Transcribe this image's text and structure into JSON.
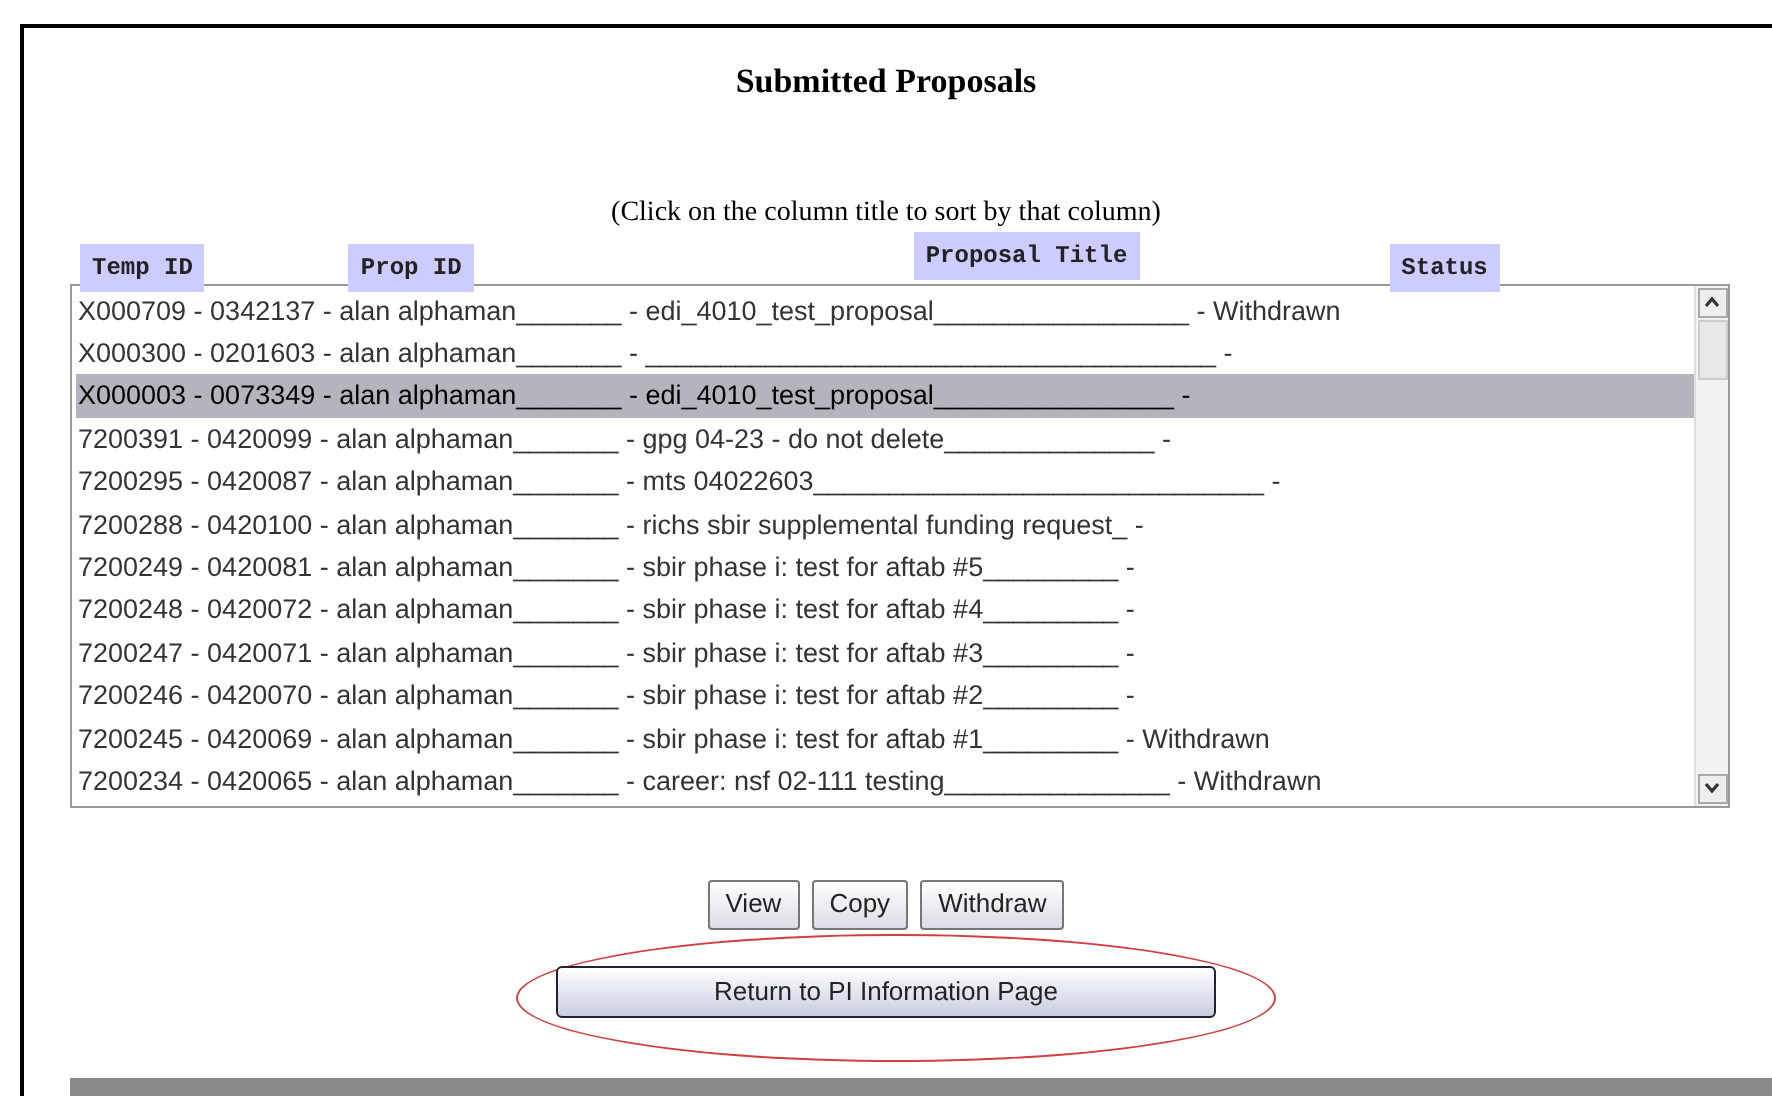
{
  "title": "Submitted Proposals",
  "hint": "(Click on the column title to sort by that column)",
  "columns": [
    "Temp ID",
    "Prop ID",
    "Proposal Title",
    "Status"
  ],
  "rows": [
    {
      "text": "X000709 - 0342137 - alan alphaman_______ - edi_4010_test_proposal_________________ - Withdrawn",
      "selected": false
    },
    {
      "text": "X000300 - 0201603 - alan alphaman_______ - ______________________________________ -",
      "selected": false
    },
    {
      "text": "X000003 - 0073349 - alan alphaman_______ - edi_4010_test_proposal________________ -",
      "selected": true
    },
    {
      "text": "7200391 - 0420099 - alan alphaman_______ - gpg 04-23 - do not delete______________ -",
      "selected": false
    },
    {
      "text": "7200295 - 0420087 - alan alphaman_______ - mts 04022603______________________________ -",
      "selected": false
    },
    {
      "text": "7200288 - 0420100 - alan alphaman_______ - richs sbir supplemental funding request_ -",
      "selected": false
    },
    {
      "text": "7200249 - 0420081 - alan alphaman_______ - sbir phase i: test for aftab #5_________ -",
      "selected": false
    },
    {
      "text": "7200248 - 0420072 - alan alphaman_______ - sbir phase i: test for aftab #4_________ -",
      "selected": false
    },
    {
      "text": "7200247 - 0420071 - alan alphaman_______ - sbir phase i: test for aftab #3_________ -",
      "selected": false
    },
    {
      "text": "7200246 - 0420070 - alan alphaman_______ - sbir phase i: test for aftab #2_________ -",
      "selected": false
    },
    {
      "text": "7200245 - 0420069 - alan alphaman_______ - sbir phase i: test for aftab #1_________ - Withdrawn",
      "selected": false
    },
    {
      "text": "7200234 - 0420065 - alan alphaman_______ - career: nsf 02-111 testing_______________ - Withdrawn",
      "selected": false
    }
  ],
  "buttons": [
    "View",
    "Copy",
    "Withdraw"
  ],
  "return_button": "Return to PI Information Page"
}
